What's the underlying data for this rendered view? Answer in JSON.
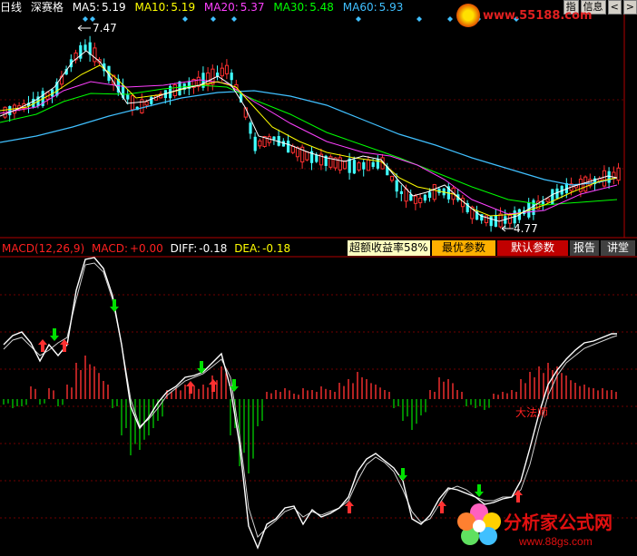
{
  "header": {
    "period": "日线",
    "stock": "深赛格",
    "ma5_label": "MA5:",
    "ma5_value": "5.19",
    "ma10_label": "MA10:",
    "ma10_value": "5.19",
    "ma20_label": "MA20:",
    "ma20_value": "5.37",
    "ma30_label": "MA30:",
    "ma30_value": "5.48",
    "ma60_label": "MA60:",
    "ma60_value": "5.93"
  },
  "sys_buttons": [
    "指",
    "信息",
    "<",
    ">"
  ],
  "watermark_logo_text": "www.55188.com",
  "price_annotations": {
    "high": "7.47",
    "low": "4.77"
  },
  "macd_bar": {
    "title": "MACD(12,26,9)",
    "macd_label": "MACD:",
    "macd_value": "+0.00",
    "diff_label": "DIFF:",
    "diff_value": "-0.18",
    "dea_label": "DEA:",
    "dea_value": "-0.18",
    "yield_label": "超额收益率58%",
    "btn_best": "最优参数",
    "btn_default": "默认参数",
    "btn_report": "报告",
    "btn_explain": "讲堂"
  },
  "annotation_dafa": "大法师",
  "brand": {
    "name": "分析家公式网",
    "url": "www.88gs.com"
  },
  "colors": {
    "ma5": "#ffffff",
    "ma10": "#ffff00",
    "ma20": "#ff40ff",
    "ma30": "#00ff00",
    "ma60": "#40c0ff",
    "up": "#ff3030",
    "down": "#40ffff",
    "grid": "#a00000",
    "hist_pos": "#ff3030",
    "hist_neg": "#00c000"
  }
}
